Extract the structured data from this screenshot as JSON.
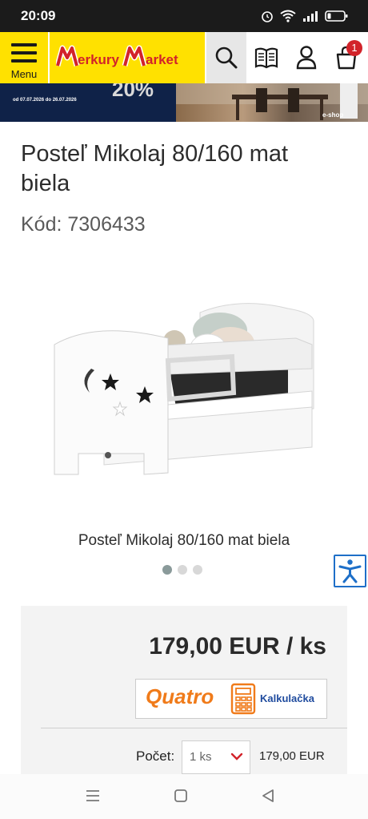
{
  "status_bar": {
    "time": "20:09",
    "battery_icon": "battery-icon",
    "signal_icon": "signal-icon",
    "wifi_icon": "wifi-icon",
    "alarm_icon": "alarm-icon"
  },
  "header": {
    "menu_label": "Menu",
    "logo_text": "MerkuryMarket",
    "cart_count": "1",
    "accent_color": "#ffe100",
    "brand_color": "#d2232a"
  },
  "banner": {
    "percent": "20%",
    "dates": "od 07.07.2026 do 26.07.2026",
    "eshop": "e-shop"
  },
  "product": {
    "title": "Posteľ Mikolaj 80/160 mat biela",
    "code": "Kód: 7306433",
    "image_caption": "Posteľ Mikolaj 80/160 mat biela",
    "gallery_count": 3,
    "gallery_active": 1
  },
  "pricing": {
    "price": "179,00 EUR / ks",
    "quatro_brand": "Quatro",
    "calculator_label": "Kalkulačka",
    "quantity_label": "Počet:",
    "quantity_value": "1 ks",
    "total": "179,00 EUR"
  }
}
